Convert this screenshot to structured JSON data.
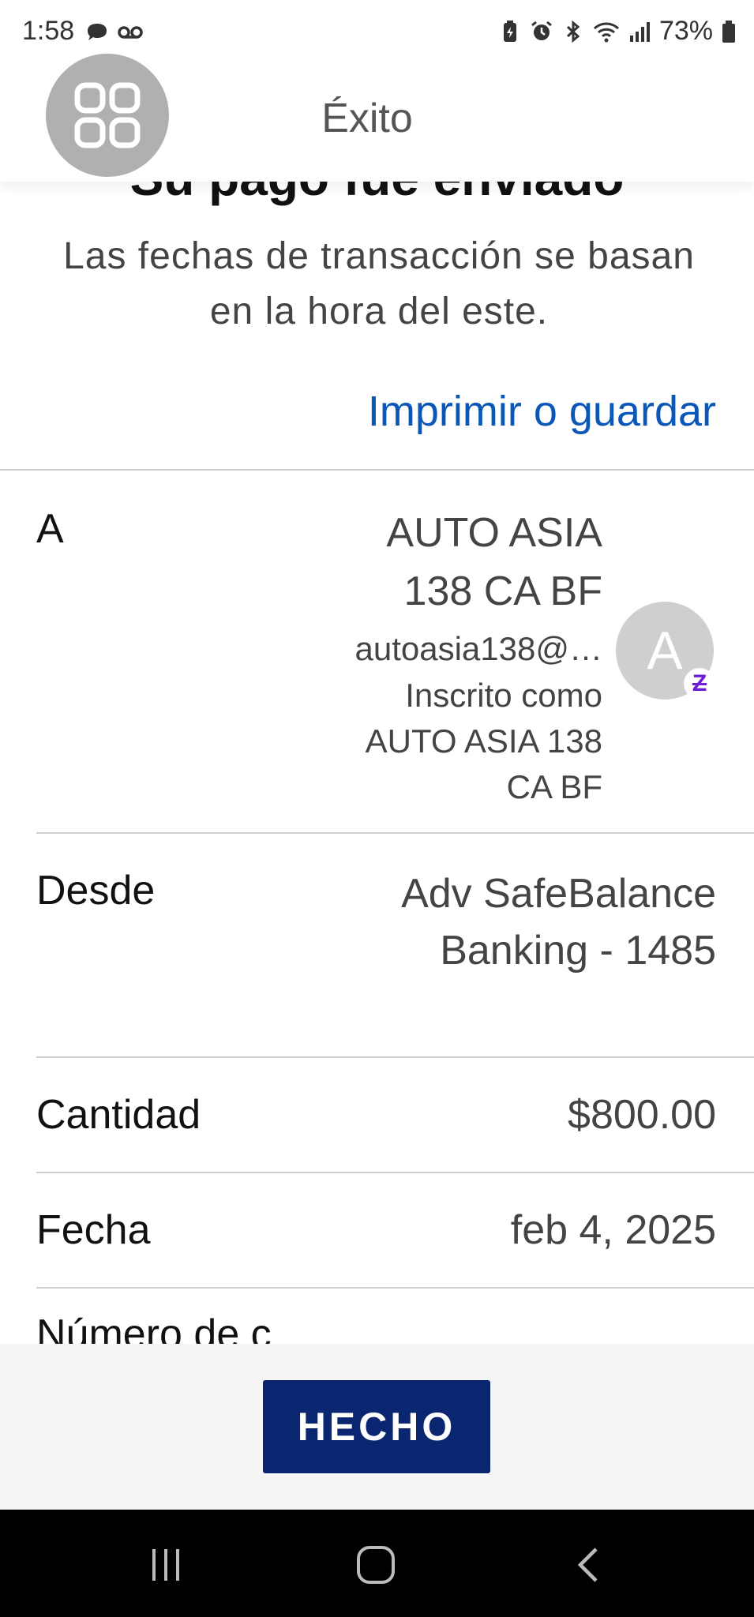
{
  "status_bar": {
    "time": "1:58",
    "battery": "73%",
    "left_icons": [
      "chat-bubble-icon",
      "voicemail-icon"
    ],
    "right_icons": [
      "battery-saver-icon",
      "alarm-icon",
      "bluetooth-icon",
      "wifi-icon",
      "signal-icon",
      "battery-icon"
    ]
  },
  "header": {
    "title": "Éxito",
    "app_button_icon": "apps-grid-icon"
  },
  "content": {
    "heading": "Su pago fue enviado",
    "subtitle": "Las fechas de transacción se basan en la hora del este.",
    "print_link": "Imprimir o guardar"
  },
  "details": {
    "to": {
      "label": "A",
      "name_line1": "AUTO ASIA",
      "name_line2": "138 CA BF",
      "email": "autoasia138@…",
      "enrolled_line1": "Inscrito como",
      "enrolled_line2": "AUTO ASIA 138",
      "enrolled_line3": "CA BF",
      "avatar_letter": "A",
      "badge": "Z"
    },
    "from": {
      "label": "Desde",
      "value_line1": "Adv SafeBalance",
      "value_line2": "Banking - 1485"
    },
    "amount": {
      "label": "Cantidad",
      "value": "$800.00"
    },
    "date": {
      "label": "Fecha",
      "value": "feb 4, 2025"
    },
    "confirmation": {
      "label": "Número de c"
    }
  },
  "actions": {
    "done": "HECHO"
  },
  "colors": {
    "link": "#0a57b8",
    "primary_button": "#0b2670",
    "zelle": "#6d1ed4"
  }
}
